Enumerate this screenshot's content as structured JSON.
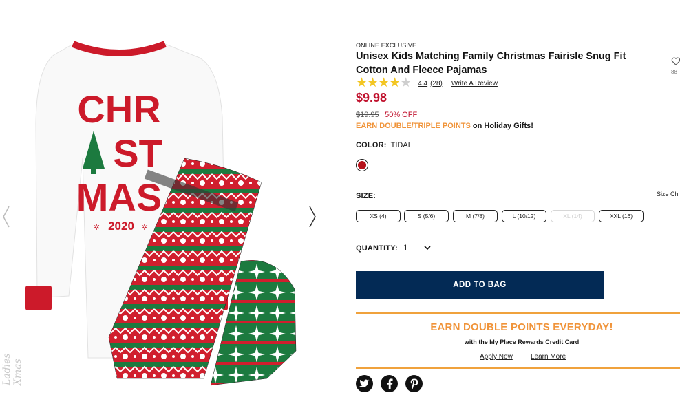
{
  "product": {
    "eyebrow": "ONLINE EXCLUSIVE",
    "title": "Unisex Kids Matching Family Christmas Fairisle Snug Fit Cotton And Fleece Pajamas",
    "rating": "4.4",
    "review_count": "(28)",
    "write_review": "Write A Review",
    "price": "$9.98",
    "original_price": "$19.95",
    "discount": "50% OFF",
    "promo_highlight": "EARN DOUBLE/TRIPLE POINTS",
    "promo_rest": " on Holiday Gifts!",
    "wishlist_count": "88"
  },
  "color": {
    "label": "COLOR:",
    "value": "TIDAL",
    "swatch_hex": "#b5121b"
  },
  "size": {
    "label": "SIZE:",
    "chart_link": "Size Ch",
    "options": [
      {
        "label": "XS (4)",
        "available": true
      },
      {
        "label": "S (5/6)",
        "available": true
      },
      {
        "label": "M (7/8)",
        "available": true
      },
      {
        "label": "L (10/12)",
        "available": true
      },
      {
        "label": "XL (14)",
        "available": false
      },
      {
        "label": "XXL (16)",
        "available": true
      }
    ]
  },
  "quantity": {
    "label": "QUANTITY:",
    "value": "1"
  },
  "cta": {
    "add_to_bag": "ADD TO BAG"
  },
  "rewards": {
    "title": "EARN DOUBLE POINTS EVERYDAY!",
    "subtitle": "with the My Place Rewards Credit Card",
    "apply": "Apply Now",
    "learn": "Learn More"
  },
  "image": {
    "shirt_text_line1": "CHR",
    "shirt_text_line2": "ST",
    "shirt_text_line3": "MAS",
    "shirt_year": "2020",
    "watermark": "Ladies Xmas"
  },
  "colors": {
    "accent_red": "#c0102c",
    "navy": "#032a55",
    "orange": "#f0943a"
  },
  "icons": [
    "chevron-left-icon",
    "chevron-right-icon",
    "heart-icon",
    "chevron-down-icon",
    "twitter-icon",
    "facebook-icon",
    "pinterest-icon"
  ]
}
